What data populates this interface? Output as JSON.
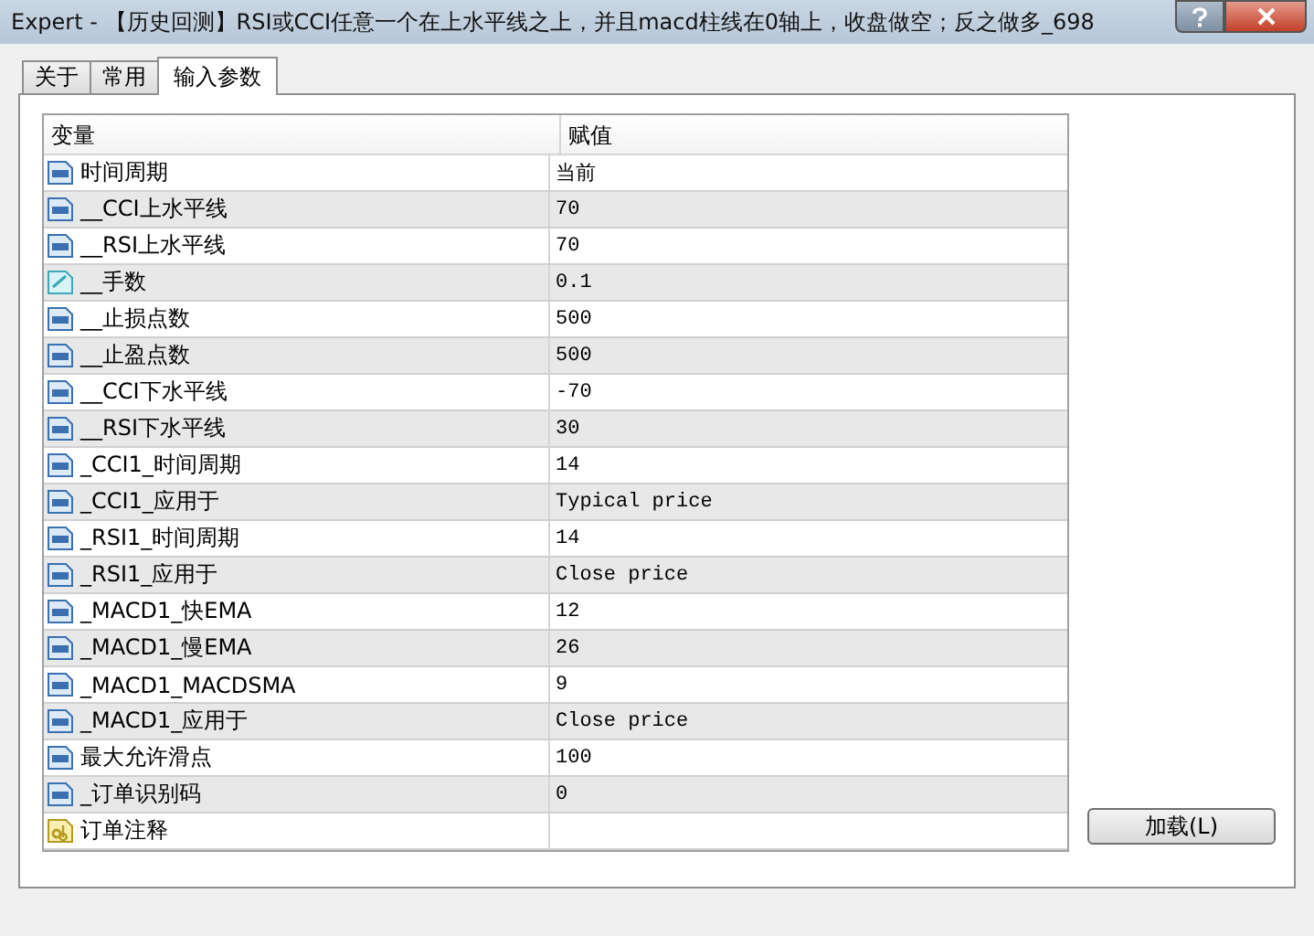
{
  "window": {
    "title": "Expert - 【历史回测】RSI或CCI任意一个在上水平线之上，并且macd柱线在0轴上，收盘做空；反之做多_698"
  },
  "tabs": [
    {
      "label": "关于",
      "selected": false
    },
    {
      "label": "常用",
      "selected": false
    },
    {
      "label": "输入参数",
      "selected": true
    }
  ],
  "table": {
    "columns": [
      "变量",
      "赋值"
    ],
    "rows": [
      {
        "kind": "int",
        "name": "时间周期",
        "value": "当前"
      },
      {
        "kind": "int",
        "name": "__CCI上水平线",
        "value": "70"
      },
      {
        "kind": "int",
        "name": "__RSI上水平线",
        "value": "70"
      },
      {
        "kind": "double",
        "name": "__手数",
        "value": "0.1"
      },
      {
        "kind": "int",
        "name": "__止损点数",
        "value": "500"
      },
      {
        "kind": "int",
        "name": "__止盈点数",
        "value": "500"
      },
      {
        "kind": "int",
        "name": "__CCI下水平线",
        "value": "-70"
      },
      {
        "kind": "int",
        "name": "__RSI下水平线",
        "value": "30"
      },
      {
        "kind": "int",
        "name": "_CCI1_时间周期",
        "value": "14"
      },
      {
        "kind": "int",
        "name": "_CCI1_应用于",
        "value": "Typical price"
      },
      {
        "kind": "int",
        "name": "_RSI1_时间周期",
        "value": "14"
      },
      {
        "kind": "int",
        "name": "_RSI1_应用于",
        "value": "Close price"
      },
      {
        "kind": "int",
        "name": "_MACD1_快EMA",
        "value": "12"
      },
      {
        "kind": "int",
        "name": "_MACD1_慢EMA",
        "value": "26"
      },
      {
        "kind": "int",
        "name": "_MACD1_MACDSMA",
        "value": "9"
      },
      {
        "kind": "int",
        "name": "_MACD1_应用于",
        "value": "Close price"
      },
      {
        "kind": "int",
        "name": "最大允许滑点",
        "value": "100"
      },
      {
        "kind": "int",
        "name": "_订单识别码",
        "value": "0"
      },
      {
        "kind": "string",
        "name": "订单注释",
        "value": ""
      }
    ]
  },
  "buttons": {
    "load": "加载(L)"
  }
}
